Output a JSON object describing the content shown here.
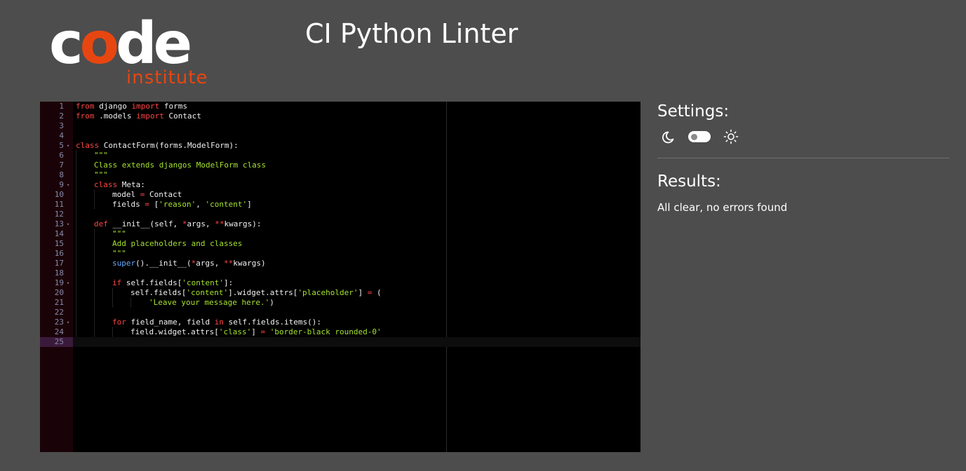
{
  "logo": {
    "word_left": "c",
    "word_accent": "o",
    "word_right": "de",
    "sub": "institute"
  },
  "page_title": "CI Python Linter",
  "editor": {
    "lines": [
      {
        "n": "1",
        "html": "<span class=\"kw\">from</span> django <span class=\"kw\">import</span> forms"
      },
      {
        "n": "2",
        "html": "<span class=\"kw\">from</span> .models <span class=\"kw\">import</span> Contact"
      },
      {
        "n": "3",
        "html": ""
      },
      {
        "n": "4",
        "html": ""
      },
      {
        "n": "5",
        "fold": true,
        "html": "<span class=\"kw\">class</span> ContactForm(forms.ModelForm):"
      },
      {
        "n": "6",
        "html": "<span class=\"guide\"></span><span class=\"str\">\"\"\"</span>"
      },
      {
        "n": "7",
        "html": "<span class=\"guide\"></span><span class=\"str\">Class extends djangos ModelForm class</span>"
      },
      {
        "n": "8",
        "html": "<span class=\"guide\"></span><span class=\"str\">\"\"\"</span>"
      },
      {
        "n": "9",
        "fold": true,
        "html": "<span class=\"guide\"></span><span class=\"kw\">class</span> Meta:"
      },
      {
        "n": "10",
        "html": "<span class=\"guide\"></span><span class=\"guide\"></span>model <span class=\"kw\">=</span> Contact"
      },
      {
        "n": "11",
        "html": "<span class=\"guide\"></span><span class=\"guide\"></span>fields <span class=\"kw\">=</span> [<span class=\"str\">'reason'</span>, <span class=\"str\">'content'</span>]"
      },
      {
        "n": "12",
        "html": "<span class=\"guide\"></span>"
      },
      {
        "n": "13",
        "fold": true,
        "html": "<span class=\"guide\"></span><span class=\"kw\">def</span> __init__(self, <span class=\"kw\">*</span>args, <span class=\"kw\">**</span>kwargs):"
      },
      {
        "n": "14",
        "html": "<span class=\"guide\"></span><span class=\"guide\"></span><span class=\"str\">\"\"\"</span>"
      },
      {
        "n": "15",
        "html": "<span class=\"guide\"></span><span class=\"guide\"></span><span class=\"str\">Add placeholders and classes</span>"
      },
      {
        "n": "16",
        "html": "<span class=\"guide\"></span><span class=\"guide\"></span><span class=\"str\">\"\"\"</span>"
      },
      {
        "n": "17",
        "html": "<span class=\"guide\"></span><span class=\"guide\"></span><span class=\"fn\">super</span>().__init__(<span class=\"kw\">*</span>args, <span class=\"kw\">**</span>kwargs)"
      },
      {
        "n": "18",
        "html": "<span class=\"guide\"></span><span class=\"guide\"></span>"
      },
      {
        "n": "19",
        "fold": true,
        "html": "<span class=\"guide\"></span><span class=\"guide\"></span><span class=\"kw\">if</span> self.fields[<span class=\"str\">'content'</span>]:"
      },
      {
        "n": "20",
        "html": "<span class=\"guide\"></span><span class=\"guide\"></span><span class=\"guide\"></span>self.fields[<span class=\"str\">'content'</span>].widget.attrs[<span class=\"str\">'placeholder'</span>] <span class=\"kw\">=</span> ("
      },
      {
        "n": "21",
        "html": "<span class=\"guide\"></span><span class=\"guide\"></span><span class=\"guide\"></span><span class=\"guide\"></span><span class=\"str\">'Leave your message here.'</span>)"
      },
      {
        "n": "22",
        "html": "<span class=\"guide\"></span><span class=\"guide\"></span>"
      },
      {
        "n": "23",
        "fold": true,
        "html": "<span class=\"guide\"></span><span class=\"guide\"></span><span class=\"kw\">for</span> field_name, field <span class=\"kw\">in</span> self.fields.items():"
      },
      {
        "n": "24",
        "html": "<span class=\"guide\"></span><span class=\"guide\"></span><span class=\"guide\"></span>field.widget.attrs[<span class=\"str\">'class'</span>] <span class=\"kw\">=</span> <span class=\"str\">'border-black rounded-0'</span>"
      },
      {
        "n": "25",
        "active": true,
        "html": ""
      }
    ]
  },
  "settings": {
    "title": "Settings:",
    "theme_toggle": {
      "dark_icon": "moon-icon",
      "light_icon": "sun-icon",
      "checked": false
    }
  },
  "results": {
    "title": "Results:",
    "message": "All clear, no errors found"
  },
  "colors": {
    "background": "#4d4d4d",
    "brand_accent": "#e84610",
    "editor_bg": "#000000",
    "keyword": "#ff4444",
    "string": "#a6e22e"
  }
}
